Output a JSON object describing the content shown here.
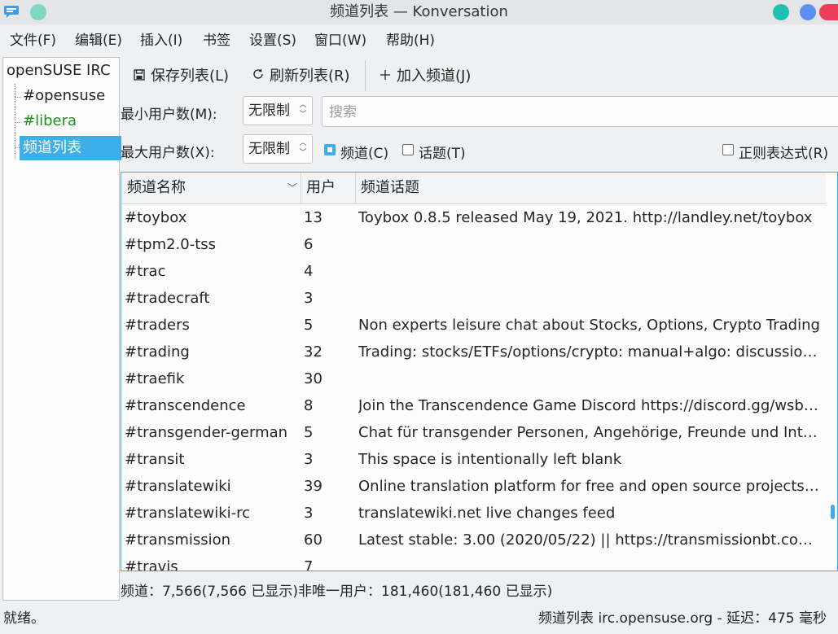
{
  "window": {
    "title": "频道列表 — Konversation"
  },
  "menubar": [
    "文件(F)",
    "编辑(E)",
    "插入(I)",
    "书签",
    "设置(S)",
    "窗口(W)",
    "帮助(H)"
  ],
  "tree": {
    "root": "openSUSE IRC",
    "items": [
      "#opensuse",
      "#libera",
      "频道列表"
    ]
  },
  "toolbar": {
    "save": "保存列表(L)",
    "refresh": "刷新列表(R)",
    "join": "加入频道(J)"
  },
  "filters": {
    "min_users_label": "最小用户数(M):",
    "min_users_value": "无限制",
    "max_users_label": "最大用户数(X):",
    "max_users_value": "无限制",
    "search_placeholder": "搜索",
    "channel_cb": "频道(C)",
    "channel_checked": true,
    "topic_cb": "话题(T)",
    "topic_checked": false,
    "regex_cb": "正则表达式(R)",
    "regex_checked": false
  },
  "table": {
    "columns": [
      "频道名称",
      "用户",
      "频道话题"
    ],
    "rows": [
      [
        "#toybox",
        "13",
        "Toybox 0.8.5 released May 19, 2021. http://landley.net/toybox"
      ],
      [
        "#tpm2.0-tss",
        "6",
        ""
      ],
      [
        "#trac",
        "4",
        ""
      ],
      [
        "#tradecraft",
        "3",
        ""
      ],
      [
        "#traders",
        "5",
        "Non experts leisure chat about Stocks, Options, Crypto Trading"
      ],
      [
        "#trading",
        "32",
        "Trading: stocks/ETFs/options/crypto: manual+algo: discussion …"
      ],
      [
        "#traefik",
        "30",
        ""
      ],
      [
        "#transcendence",
        "8",
        "Join the Transcendence Game Discord https://discord.gg/wsbS…"
      ],
      [
        "#transgender-german",
        "5",
        "Chat für transgender Personen, Angehörige, Freunde und Int…"
      ],
      [
        "#transit",
        "3",
        "This space is intentionally left blank"
      ],
      [
        "#translatewiki",
        "39",
        "Online translation platform for free and open source projects …"
      ],
      [
        "#translatewiki-rc",
        "3",
        "translatewiki.net live changes feed"
      ],
      [
        "#transmission",
        "60",
        "Latest stable: 3.00 (2020/05/22) || https://transmissionbt.com…"
      ],
      [
        "#travis",
        "7",
        ""
      ]
    ]
  },
  "summary": "频道：7,566(7,566 已显示)非唯一用户：181,460(181,460 已显示)",
  "statusbar": {
    "left": "就绪。",
    "right": "频道列表 irc.opensuse.org - 延迟：475 毫秒"
  }
}
